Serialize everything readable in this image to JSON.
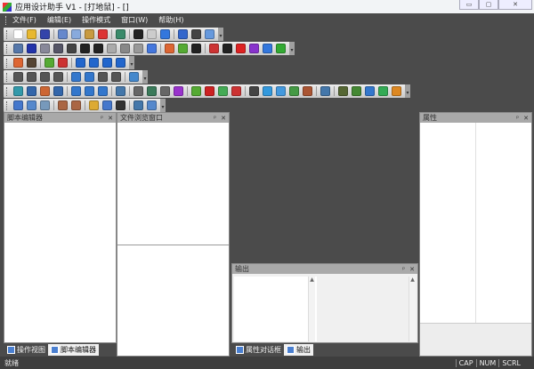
{
  "window": {
    "title": "应用设计助手 V1 - [打地鼠] - []",
    "minimize": "▭",
    "maximize": "▢",
    "close": "✕"
  },
  "menu": [
    {
      "label": "文件(F)"
    },
    {
      "label": "编辑(E)"
    },
    {
      "label": "操作模式"
    },
    {
      "label": "窗口(W)"
    },
    {
      "label": "帮助(H)"
    }
  ],
  "toolbars": [
    [
      "new-file:#fff",
      "open-folder:#e8b830",
      "save:#3344aa",
      "|",
      "cut:#6688cc",
      "copy:#88aadd",
      "paste:#c89a40",
      "delete:#dd3333",
      "|",
      "refresh:#3a8a6a",
      "|",
      "pointer:#222",
      "grid:#ccc",
      "chart:#3377dd",
      "|",
      "help:#3366cc",
      "device:#444",
      "image:#6699dd"
    ],
    [
      "form:#5577aa",
      "b2-text:#2233aa",
      "label:#889",
      "abc-text:#556",
      "checkbox:#444",
      "st-text:#222",
      "edit-text:#222",
      "slider:#aaa",
      "button:#888",
      "panel:#999",
      "dots:#4477dd",
      "|",
      "palette:#dd6633",
      "check:#55aa33",
      "l-text:#222",
      "|",
      "stop:#cc3333",
      "one:#222",
      "two:#dd2222",
      "three:#8833cc",
      "four:#3377dd",
      "five:#33aa33"
    ],
    [
      "palette:#dd6633",
      "person:#554433",
      "|",
      "check:#55aa33",
      "cancel:#cc3333",
      "|",
      "play:#2266cc",
      "pause:#2266cc",
      "stop-square:#2266cc",
      "loop:#2266cc"
    ],
    [
      "align-left:#555",
      "align-right:#555",
      "align-top:#555",
      "align-bottom:#555",
      "|",
      "space-h:#3377cc",
      "space-v:#3377cc",
      "size-w:#555",
      "size-h:#555",
      "|",
      "layout:#4488cc"
    ],
    [
      "globe:#3399aa",
      "arrows:#3366aa",
      "stack:#cc6633",
      "db:#3366aa",
      "|",
      "info:#3377cc",
      "circle:#3377cc",
      "circle2:#3377cc",
      "|",
      "upload:#4477aa",
      "|",
      "move:#666",
      "rotate:#3a7a5a",
      "frame:#666",
      "curve:#9933cc",
      "|",
      "check:#55aa33",
      "rgb:#cc2222",
      "landscape:#44aa55",
      "cross-image:#cc3333",
      "|",
      "cloud:#444",
      "folder-blue:#3399dd",
      "waves:#4499dd",
      "monitor:#449944",
      "tools:#aa5533",
      "|",
      "link:#4477aa",
      "|",
      "tank:#556633",
      "turtle:#448833",
      "down:#3377cc",
      "target:#33aa55",
      "square-orange:#dd8822"
    ],
    [
      "red-add-1:#4477cc",
      "red-add-2:#5588cc",
      "red-add-3:#7799bb",
      "|",
      "red-add-4:#aa6644",
      "red-add-5:#aa6644",
      "|",
      "red-add-6:#ddaa33",
      "red-add-7:#4477cc",
      "red-add-8:#333",
      "|",
      "red-add-9:#4477aa",
      "red-add-10:#5588cc"
    ]
  ],
  "panels": {
    "script_editor": {
      "title": "脚本编辑器",
      "pin": "ᵖ",
      "close": "✕"
    },
    "file_browser": {
      "title": "文件浏览窗口",
      "pin": "ᵖ",
      "close": "✕"
    },
    "properties": {
      "title": "属性",
      "pin": "ᵖ",
      "close": "✕"
    },
    "output": {
      "title": "输出",
      "pin": "ᵖ",
      "close": "✕"
    }
  },
  "left_tabs": [
    {
      "label": "操作视图"
    },
    {
      "label": "脚本编辑器",
      "active": true
    }
  ],
  "bottom_tabs": [
    {
      "label": "属性对话框"
    },
    {
      "label": "输出",
      "active": true
    }
  ],
  "status": {
    "text": "就绪",
    "indicators": [
      "CAP",
      "NUM",
      "SCRL"
    ]
  }
}
